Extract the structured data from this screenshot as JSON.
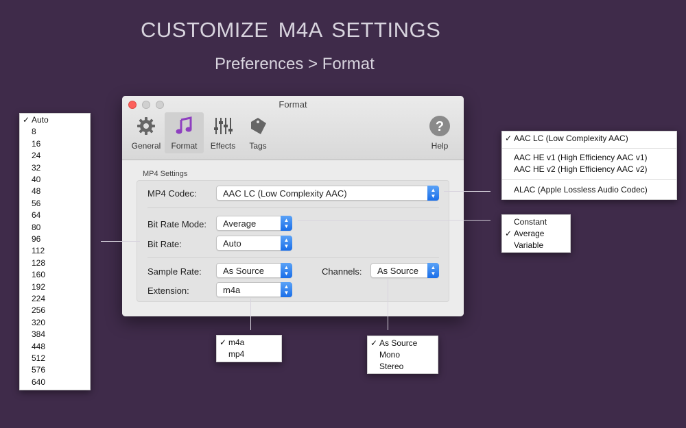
{
  "headline": "CUSTOMIZE  M4A  SETTINGS",
  "subline": "Preferences > Format",
  "window": {
    "title": "Format",
    "toolbar": [
      {
        "label": "General",
        "icon": "gear-icon"
      },
      {
        "label": "Format",
        "icon": "music-note-icon"
      },
      {
        "label": "Effects",
        "icon": "sliders-icon"
      },
      {
        "label": "Tags",
        "icon": "tag-icon"
      },
      {
        "label": "Help",
        "icon": "help-icon"
      }
    ],
    "group_label": "MP4 Settings",
    "fields": {
      "codec_label": "MP4 Codec:",
      "codec_value": "AAC LC (Low Complexity AAC)",
      "bitrate_mode_label": "Bit Rate Mode:",
      "bitrate_mode_value": "Average",
      "bitrate_label": "Bit Rate:",
      "bitrate_value": "Auto",
      "sample_rate_label": "Sample Rate:",
      "sample_rate_value": "As Source",
      "channels_label": "Channels:",
      "channels_value": "As Source",
      "extension_label": "Extension:",
      "extension_value": "m4a"
    }
  },
  "menus": {
    "bitrate": {
      "checked": "✓",
      "items": [
        "Auto",
        "8",
        "16",
        "24",
        "32",
        "40",
        "48",
        "56",
        "64",
        "80",
        "96",
        "112",
        "128",
        "160",
        "192",
        "224",
        "256",
        "320",
        "384",
        "448",
        "512",
        "576",
        "640"
      ]
    },
    "codec": {
      "checked": "✓",
      "items": [
        "AAC LC (Low Complexity AAC)",
        "AAC HE v1 (High Efficiency AAC v1)",
        "AAC HE v2 (High Efficiency AAC v2)",
        "ALAC (Apple Lossless Audio Codec)"
      ]
    },
    "bitrate_mode": {
      "checked": "✓",
      "items": [
        "Constant",
        "Average",
        "Variable"
      ]
    },
    "extension": {
      "checked": "✓",
      "items": [
        "m4a",
        "mp4"
      ]
    },
    "channels": {
      "checked": "✓",
      "items": [
        "As Source",
        "Mono",
        "Stereo"
      ]
    }
  },
  "colors": {
    "background": "#3f2b4a",
    "accent_blue": "#2a7cf0",
    "format_icon": "#8e3fc0"
  }
}
